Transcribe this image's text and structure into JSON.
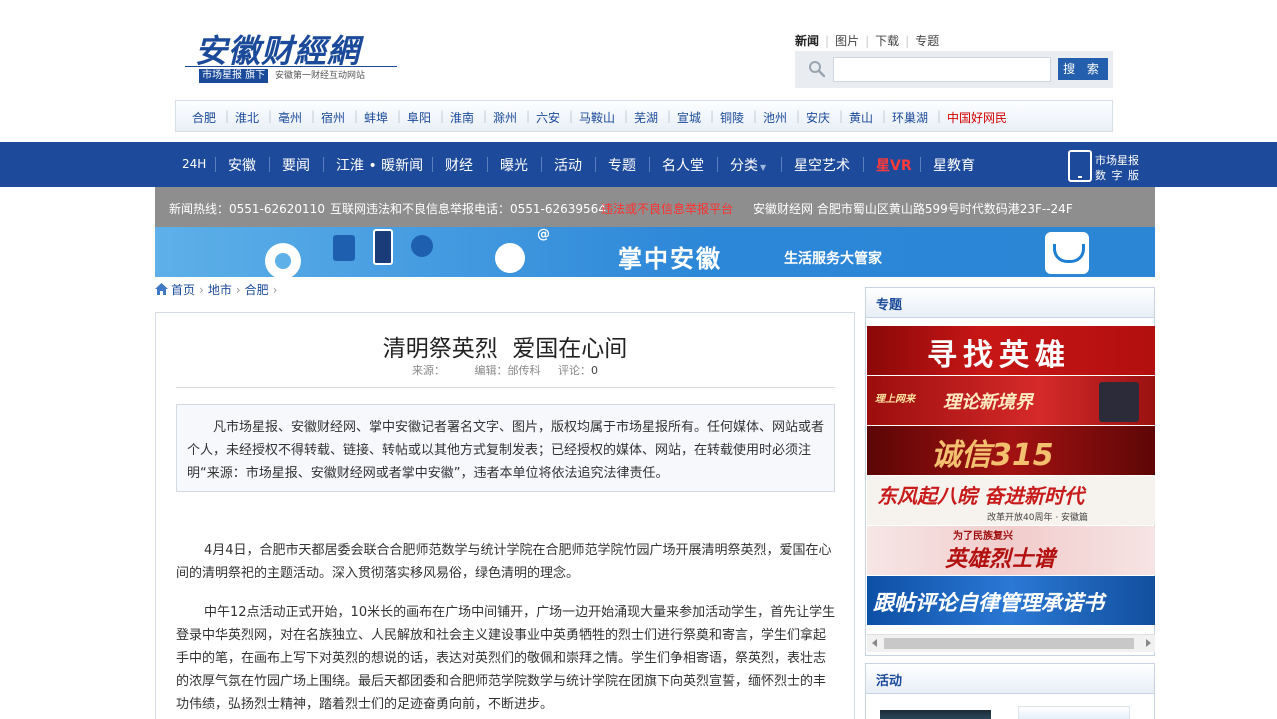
{
  "logo": {
    "name": "安徽财經網",
    "sub_brand": "市场星报 旗下",
    "slogan": "安徽第一财经互动网站"
  },
  "top_links": [
    {
      "label": "新闻",
      "active": true
    },
    {
      "label": "图片",
      "active": false
    },
    {
      "label": "下载",
      "active": false
    },
    {
      "label": "专题",
      "active": false
    }
  ],
  "search": {
    "placeholder": "",
    "button_label": "搜 索"
  },
  "cities": [
    "合肥",
    "淮北",
    "亳州",
    "宿州",
    "蚌埠",
    "阜阳",
    "淮南",
    "滁州",
    "六安",
    "马鞍山",
    "芜湖",
    "宣城",
    "铜陵",
    "池州",
    "安庆",
    "黄山",
    "环巢湖",
    "中国好网民"
  ],
  "nav": [
    "24H",
    "安徽",
    "要闻",
    "江淮 • 暖新闻",
    "财经",
    "曝光",
    "活动",
    "专题",
    "名人堂",
    "分类",
    "星空艺术",
    "星VR",
    "星教育"
  ],
  "digital_edition": {
    "line1": "市场星报",
    "line2": "数 字 版"
  },
  "hotline": {
    "news": "新闻热线：0551-62620110",
    "report": "互联网违法和不良信息举报电话：0551-62639564",
    "report_link": "违法或不良信息举报平台",
    "address": "安徽财经网 合肥市蜀山区黄山路599号时代数码港23F--24F"
  },
  "banner": {
    "title": "掌中安徽",
    "subtitle": "生活服务大管家"
  },
  "breadcrumb": [
    "首页",
    "地市",
    "合肥"
  ],
  "article": {
    "title": "清明祭英烈  爱国在心间",
    "source_label": "来源：",
    "source_value": "",
    "editor_label": "编辑：",
    "editor_value": "邰传科",
    "comments_label": "评论：",
    "comments_value": "0",
    "notice": "凡市场星报、安徽财经网、掌中安徽记者署名文字、图片，版权均属于市场星报所有。任何媒体、网站或者个人，未经授权不得转载、链接、转帖或以其他方式复制发表；已经授权的媒体、网站，在转载使用时必须注明“来源：市场星报、安徽财经网或者掌中安徽”，违者本单位将依法追究法律责任。",
    "paragraphs": [
      "4月4日，合肥市天都居委会联合合肥师范数学与统计学院在合肥师范学院竹园广场开展清明祭英烈，爱国在心间的清明祭祀的主题活动。深入贯彻落实移风易俗，绿色清明的理念。",
      "中午12点活动正式开始，10米长的画布在广场中间铺开，广场一边开始涌现大量来参加活动学生，首先让学生登录中华英烈网，对在名族独立、人民解放和社会主义建设事业中英勇牺牲的烈士们进行祭奠和寄言，学生们拿起手中的笔，在画布上写下对英烈的想说的话，表达对英烈们的敬佩和崇拜之情。学生们争相寄语，祭英烈，表壮志的浓厚气氛在竹园广场上围绕。最后天都团委和合肥师范学院数学与统计学院在团旗下向英烈宣誓，缅怀烈士的丰功伟绩，弘扬烈士精神，踏着烈士们的足迹奋勇向前，不断进步。"
    ]
  },
  "sidebar": {
    "topics_title": "专题",
    "promos": [
      {
        "text": "寻找英雄",
        "bg": "#b80f0f"
      },
      {
        "text": "理论新境界",
        "small": "理上网来",
        "bg": "#c21a1a"
      },
      {
        "text": "诚信315",
        "bg": "#8a0c0c"
      },
      {
        "text": "东风起八皖 奋进新时代",
        "small": "改革开放40周年 · 安徽篇",
        "bg": "#f7f2ec"
      },
      {
        "text": "英雄烈士谱",
        "small": "为了民族复兴",
        "bg": "#f3dada"
      },
      {
        "text": "跟帖评论自律管理承诺书",
        "bg": "#1f65c4"
      }
    ],
    "activities_title": "活动"
  },
  "colors": {
    "brand_blue": "#1d4a9a",
    "alert_red": "#d10000",
    "hotline_gray": "#8e8e8e"
  }
}
